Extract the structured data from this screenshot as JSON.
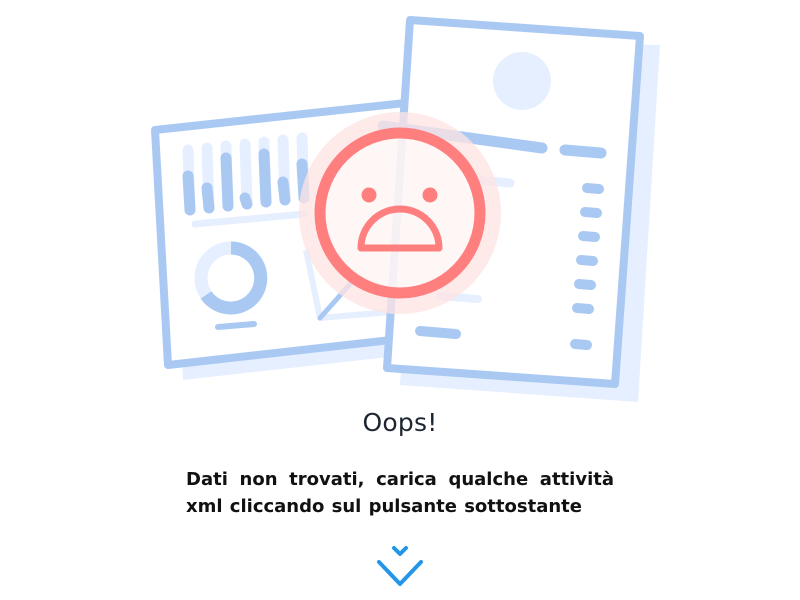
{
  "empty_state": {
    "title": "Oops!",
    "message": "Dati non trovati, carica qualche attività xml cliccando sul pulsante sottostante",
    "scroll_icon": "double-chevron-down-icon"
  },
  "colors": {
    "illustration_blue": "#a9c9f3",
    "illustration_light_blue": "#e6efff",
    "sad_face_red": "#ff7f7f",
    "sad_face_glow": "#ffe3e3",
    "title_text": "#1c2530",
    "message_text": "#111111",
    "chevron_blue": "#2496ea"
  }
}
